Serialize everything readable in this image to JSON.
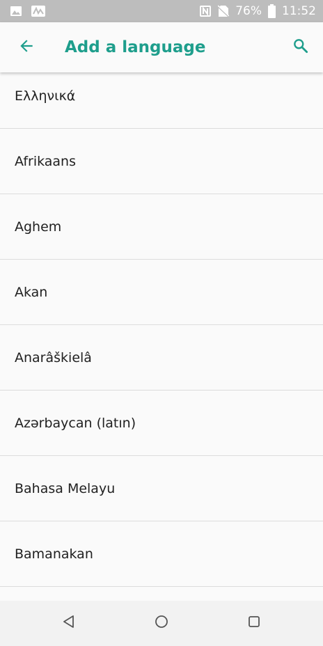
{
  "status_bar": {
    "battery_percent": "76%",
    "time": "11:52",
    "icons": [
      "image-icon",
      "voicemail-icon",
      "nfc-icon",
      "no-sim-icon",
      "battery-icon"
    ]
  },
  "app_bar": {
    "title": "Add a language",
    "back_icon": "arrow-back-icon",
    "search_icon": "search-icon"
  },
  "languages": [
    "Ελληνικά",
    "Afrikaans",
    "Aghem",
    "Akan",
    "Anarâškielâ",
    "Azərbaycan (latın)",
    "Bahasa Melayu",
    "Bamanakan"
  ],
  "nav_bar": {
    "icons": [
      "nav-back-icon",
      "nav-home-icon",
      "nav-recents-icon"
    ]
  },
  "colors": {
    "accent": "#1e9e8c",
    "status_bar_bg": "#bdbdbd",
    "background": "#fafafa",
    "divider": "#dcdcdc",
    "text_primary": "#212121"
  }
}
